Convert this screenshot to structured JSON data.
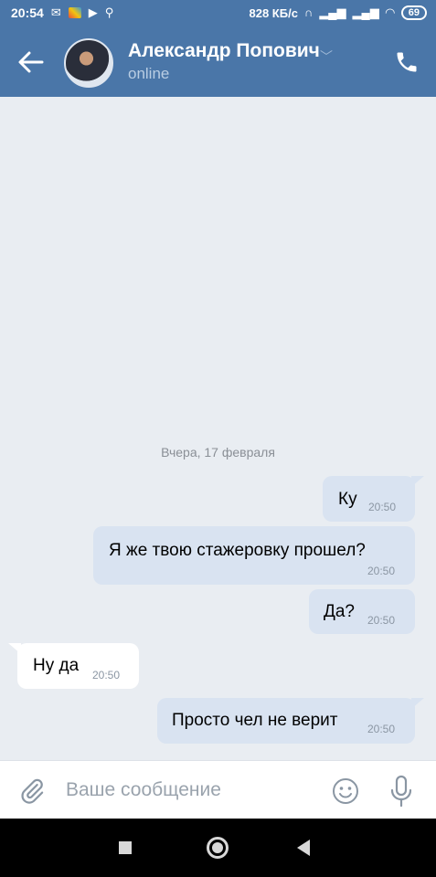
{
  "status_bar": {
    "time": "20:54",
    "speed": "828 КБ/с",
    "battery": "69"
  },
  "header": {
    "contact_name": "Александр Попович",
    "contact_status": "online"
  },
  "chat": {
    "date_separator": "Вчера, 17 февраля",
    "messages": [
      {
        "direction": "out",
        "text": "Ку",
        "time": "20:50"
      },
      {
        "direction": "out",
        "text": "Я же твою стажеровку прошел?",
        "time": "20:50"
      },
      {
        "direction": "out",
        "text": "Да?",
        "time": "20:50"
      },
      {
        "direction": "in",
        "text": "Ну да",
        "time": "20:50"
      },
      {
        "direction": "out",
        "text": "Просто чел не верит",
        "time": "20:50"
      }
    ]
  },
  "composer": {
    "placeholder": "Ваше сообщение"
  },
  "colors": {
    "header_bg": "#4a76a8",
    "outgoing_bubble": "#d9e3f1",
    "incoming_bubble": "#ffffff",
    "chat_bg": "#e9edf2"
  }
}
